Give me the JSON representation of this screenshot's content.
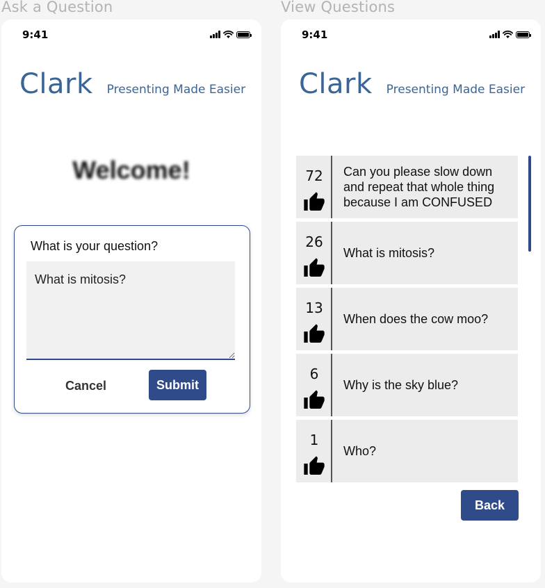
{
  "frames": {
    "ask": {
      "title": "Ask a Question",
      "status_time": "9:41",
      "brand_name": "Clark",
      "brand_tagline": "Presenting Made Easier",
      "welcome": "Welcome!",
      "dialog": {
        "prompt": "What is your question?",
        "input_value": "What is mitosis?",
        "cancel_label": "Cancel",
        "submit_label": "Submit"
      }
    },
    "view": {
      "title": "View Questions",
      "status_time": "9:41",
      "brand_name": "Clark",
      "brand_tagline": "Presenting Made Easier",
      "questions": [
        {
          "votes": "72",
          "text": "Can you please slow down and repeat that whole thing because I am CONFUSED"
        },
        {
          "votes": "26",
          "text": "What is mitosis?"
        },
        {
          "votes": "13",
          "text": "When does the cow moo?"
        },
        {
          "votes": "6",
          "text": "Why is the sky blue?"
        },
        {
          "votes": "1",
          "text": "Who?"
        }
      ],
      "back_label": "Back"
    }
  },
  "icons": {
    "vote": "thumbs-up-icon",
    "signal": "cellular-signal-icon",
    "wifi": "wifi-icon",
    "battery": "battery-icon"
  },
  "colors": {
    "accent": "#2f4b8a",
    "brand": "#3b6596",
    "row_bg": "#ececec",
    "canvas_bg": "#f5f5f5"
  }
}
